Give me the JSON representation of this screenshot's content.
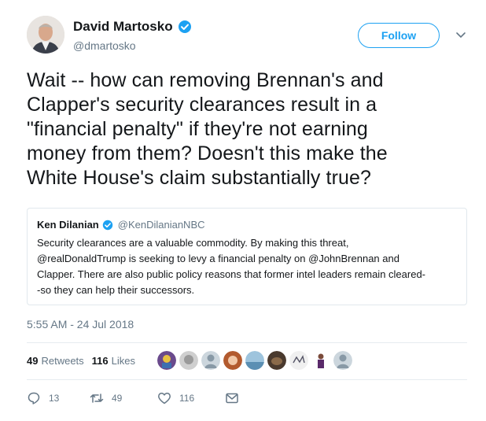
{
  "author": {
    "name": "David Martosko",
    "handle": "@dmartosko"
  },
  "follow_label": "Follow",
  "tweet_lines": [
    "Wait -- how can removing Brennan's and",
    "Clapper's security clearances result in a",
    "\"financial penalty\" if they're not earning",
    "money from them? Doesn't this make the",
    "White House's claim substantially true?"
  ],
  "quoted": {
    "name": "Ken Dilanian",
    "handle": "@KenDilanianNBC",
    "lines": [
      "Security clearances are a valuable commodity.  By making this threat,",
      "@realDonaldTrump is seeking to levy a financial penalty on @JohnBrennan and",
      "Clapper.  There are also public policy reasons that former intel leaders remain cleared-",
      "-so they can help their successors."
    ]
  },
  "timestamp": "5:55 AM - 24 Jul 2018",
  "stats": {
    "retweets_count": "49",
    "retweets_label": "Retweets",
    "likes_count": "116",
    "likes_label": "Likes"
  },
  "actions": {
    "reply_count": "13",
    "retweet_count": "49",
    "like_count": "116"
  },
  "colors": {
    "accent": "#1da1f2",
    "secondary_text": "#657786",
    "border": "#e1e8ed"
  }
}
